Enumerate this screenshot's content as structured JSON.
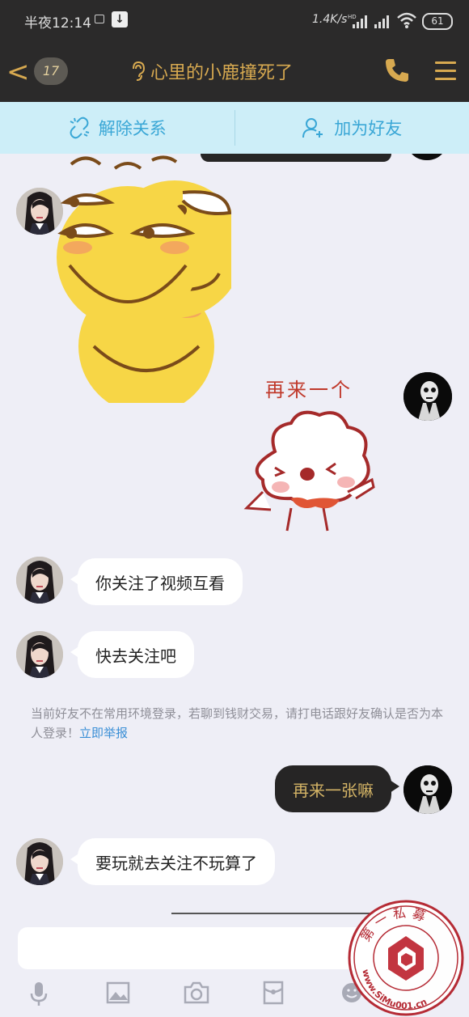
{
  "status_bar": {
    "time": "半夜12:14",
    "network_speed": "1.4K/s",
    "hd_label": "HD",
    "battery": "61"
  },
  "header": {
    "back_label": "<",
    "unread_count": "17",
    "title": "心里的小鹿撞死了"
  },
  "actions": {
    "remove_relation": "解除关系",
    "add_friend": "加为好友"
  },
  "stickers": {
    "reply_sticker_caption": "再来一个"
  },
  "messages": [
    {
      "side": "left",
      "text": "你关注了视频互看"
    },
    {
      "side": "left",
      "text": "快去关注吧"
    },
    {
      "side": "right",
      "text": "再来一张嘛"
    },
    {
      "side": "left",
      "text": "要玩就去关注不玩算了"
    }
  ],
  "notice": {
    "text": "当前好友不在常用环境登录，若聊到钱财交易，请打电话跟好友确认是否为本人登录！",
    "link": "立即举报"
  },
  "watermark": {
    "top_text": "第一私募",
    "bottom_text": "www.SiMu001.cn"
  },
  "colors": {
    "header_bg": "#2b2a2a",
    "accent_gold": "#d7a950",
    "action_bar_bg": "#cdeef8",
    "action_blue": "#3aa7d6",
    "chat_bg": "#eeeef6",
    "my_bubble": "#262525"
  }
}
